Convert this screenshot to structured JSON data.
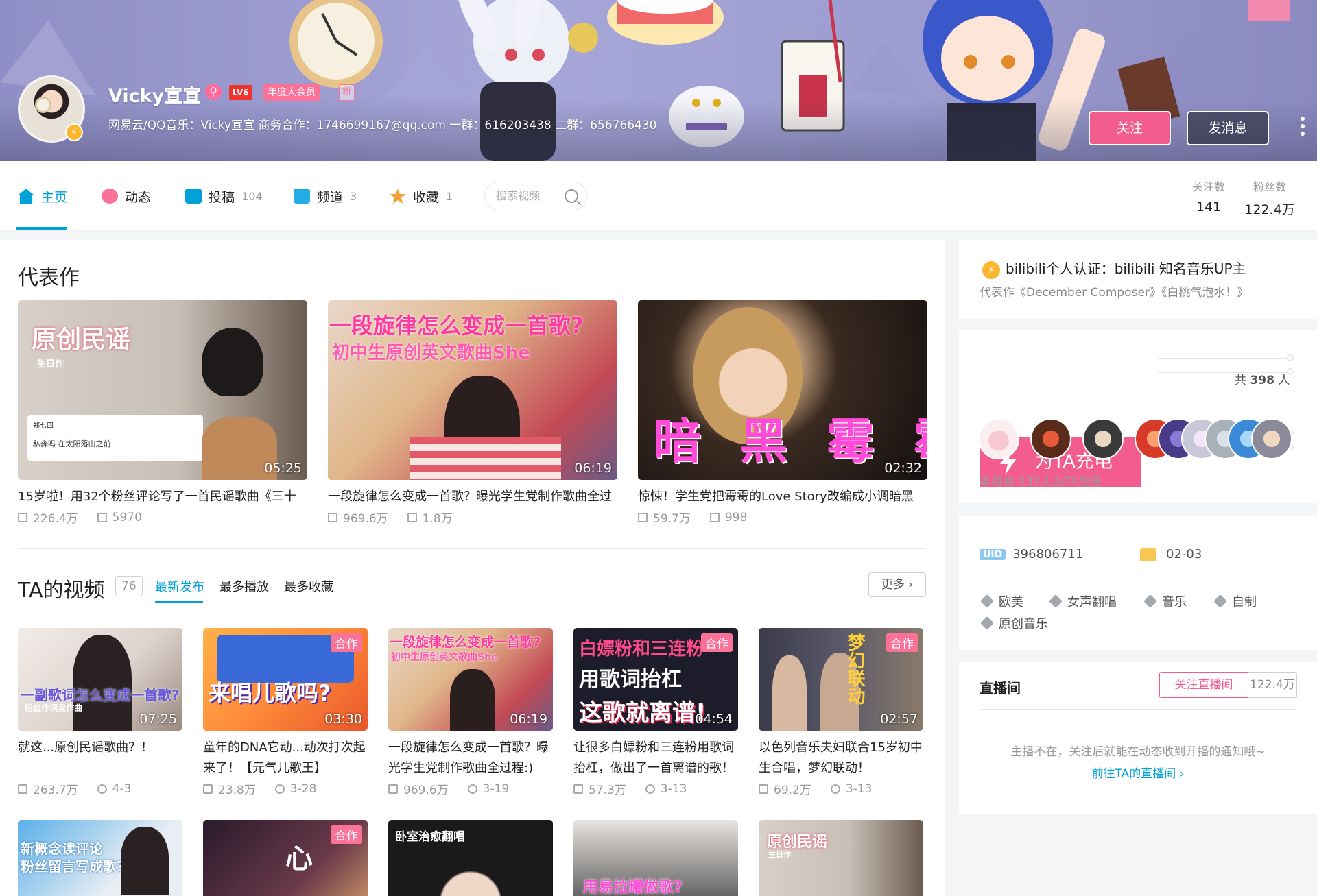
{
  "profile": {
    "name": "Vicky宣宣",
    "gender_icon": "♀",
    "level": "LV6",
    "vip_label": "年度大会员",
    "fan_badge": "粉",
    "sign": "网易云/QQ音乐：Vicky宣宣 商务合作：1746699167@qq.com 一群：616203438 二群：656766430",
    "follow_label": "关注",
    "message_label": "发消息"
  },
  "nav": {
    "home": "主页",
    "dynamic": "动态",
    "upload": "投稿",
    "upload_count": "104",
    "channel": "频道",
    "channel_count": "3",
    "favorite": "收藏",
    "favorite_count": "1",
    "search_placeholder": "搜索视频",
    "following_label": "关注数",
    "following": "141",
    "fans_label": "粉丝数",
    "fans": "122.4万"
  },
  "masterpiece": {
    "title": "代表作",
    "items": [
      {
        "title": "15岁啦！用32个粉丝评论写了一首民谣歌曲《三十",
        "duration": "05:25",
        "plays": "226.4万",
        "danmaku": "5970",
        "overlay_1": "原创民谣",
        "overlay_2": "生日作",
        "comment_name": "郑七四",
        "comment_text": "私奔吗 在太阳落山之前"
      },
      {
        "title": "一段旋律怎么变成一首歌？曝光学生党制作歌曲全过",
        "duration": "06:19",
        "plays": "969.6万",
        "danmaku": "1.8万",
        "overlay_1": "一段旋律怎么变成一首歌?",
        "overlay_2": "初中生原创英文歌曲She"
      },
      {
        "title": "惊悚！学生党把霉霉的Love Story改编成小调暗黑",
        "duration": "02:32",
        "plays": "59.7万",
        "danmaku": "998",
        "overlay_1": "暗 黑 霉 霉"
      }
    ]
  },
  "videos": {
    "title": "TA的视频",
    "count": "76",
    "tabs": [
      "最新发布",
      "最多播放",
      "最多收藏"
    ],
    "more": "更多",
    "items": [
      {
        "title_1": "就这...原创民谣歌曲？！",
        "title_2": "",
        "duration": "07:25",
        "plays": "263.7万",
        "date": "4-3",
        "overlay": "一副歌词怎么变成一首歌?",
        "overlay_2": "粉丝作词我作曲"
      },
      {
        "title_1": "童年的DNA它动...动次打次起",
        "title_2": "来了！【元气儿歌王】",
        "duration": "03:30",
        "plays": "23.8万",
        "date": "3-28",
        "badge": "合作",
        "overlay": "来唱儿歌吗?"
      },
      {
        "title_1": "一段旋律怎么变成一首歌？曝",
        "title_2": "光学生党制作歌曲全过程:)",
        "duration": "06:19",
        "plays": "969.6万",
        "date": "3-19",
        "overlay": "一段旋律怎么变成一首歌?",
        "overlay_2": "初中生原创英文歌曲She"
      },
      {
        "title_1": "让很多白嫖粉和三连粉用歌词",
        "title_2": "抬杠，做出了一首离谱的歌！",
        "duration": "04:54",
        "plays": "57.3万",
        "date": "3-13",
        "badge": "合作",
        "overlay": "白嫖粉和三连粉",
        "overlay_2": "用歌词抬杠",
        "overlay_3": "这歌就离谱!"
      },
      {
        "title_1": "以色列音乐夫妇联合15岁初中",
        "title_2": "生合唱，梦幻联动！",
        "duration": "02:57",
        "plays": "69.2万",
        "date": "3-13",
        "badge": "合作",
        "overlay": "梦幻联动"
      }
    ],
    "row2": [
      {
        "overlay": "新概念读评论",
        "overlay_2": "粉丝留言写成歌?"
      },
      {
        "badge": "合作",
        "overlay": "心"
      },
      {
        "overlay": "卧室治愈翻唱"
      },
      {
        "overlay": "用易拉罐做歌?"
      },
      {
        "overlay": "原创民谣",
        "overlay_2": "生日作"
      }
    ]
  },
  "sidebar": {
    "verify": "bilibili个人认证：bilibili 知名音乐UP主",
    "verify_sub": "代表作《December Composer》《白桃气泡水！》",
    "charge_label": "为TA充电",
    "charge_total_prefix": "共",
    "charge_total": "398",
    "charge_total_suffix": "人",
    "charge_month": "本月共 132人为TA充电",
    "uid_label": "UID",
    "uid": "396806711",
    "birthday": "02-03",
    "tags": [
      "欧美",
      "女声翻唱",
      "音乐",
      "自制",
      "原创音乐"
    ],
    "live_title": "直播间",
    "live_follow": "关注直播间",
    "live_fans": "122.4万",
    "live_notice": "主播不在，关注后就能在动态收到开播的通知哦~",
    "live_link": "前往TA的直播间"
  },
  "colors": {
    "accent": "#00a1d6",
    "pink": "#fb7299",
    "follow": "#f25d8e"
  }
}
